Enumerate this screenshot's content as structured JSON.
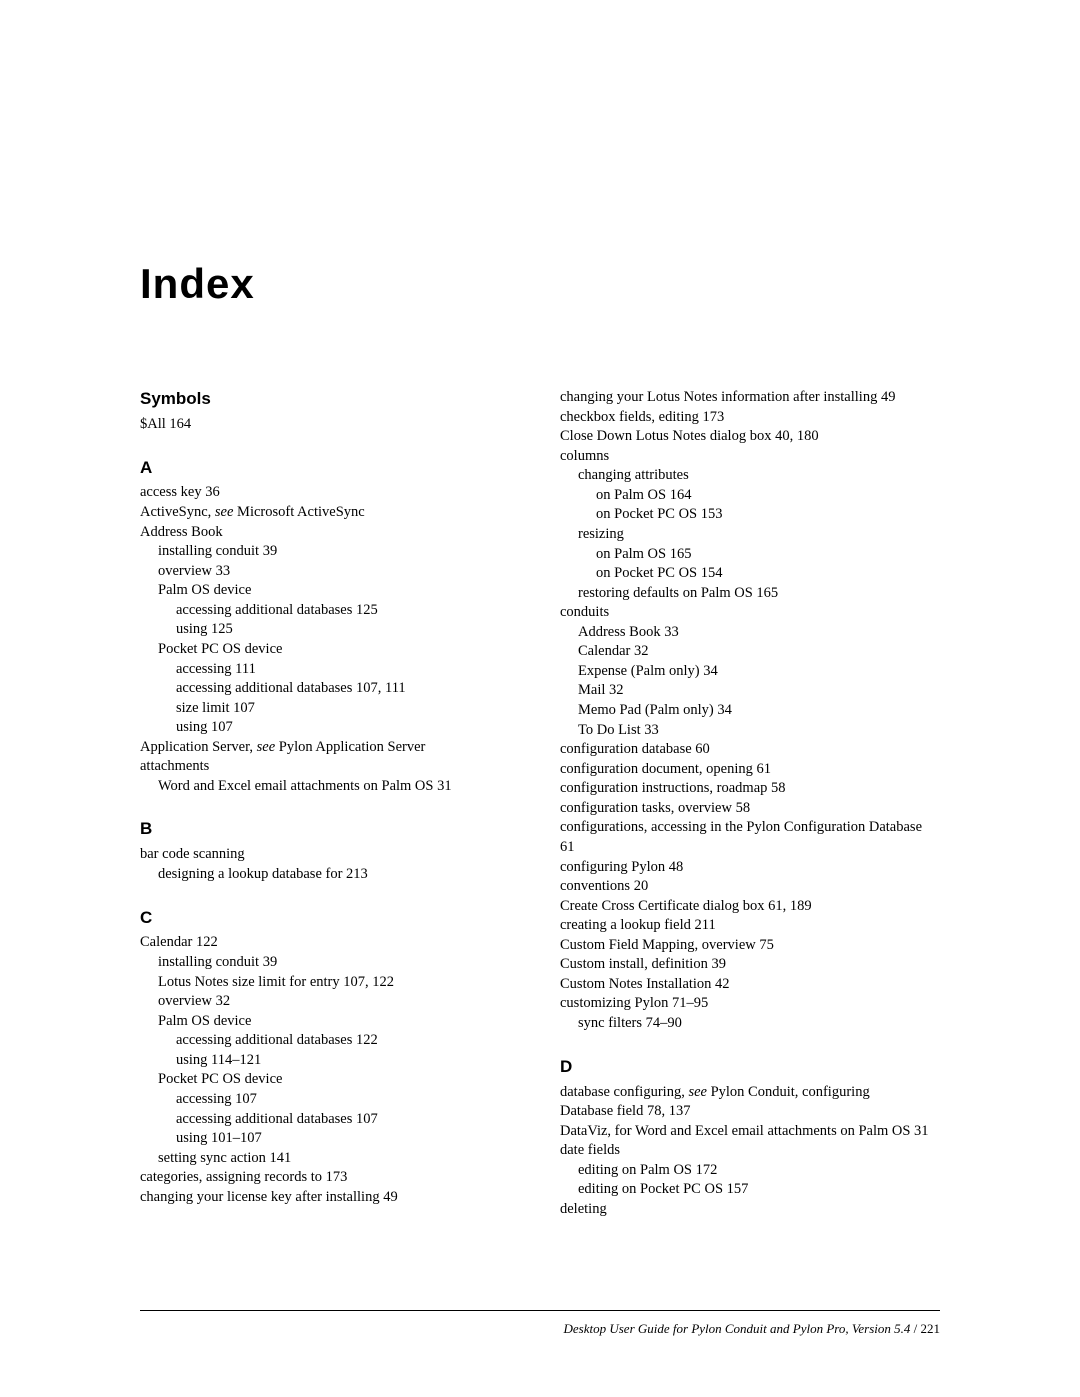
{
  "title": "Index",
  "sections": [
    {
      "head": "Symbols",
      "first": true,
      "lines": [
        [
          "$All  164",
          0
        ]
      ]
    },
    {
      "head": "A",
      "lines": [
        [
          "access key  36",
          0
        ],
        [
          "ActiveSync, <i>see</i> Microsoft ActiveSync",
          0
        ],
        [
          "Address Book",
          0
        ],
        [
          "installing conduit  39",
          1
        ],
        [
          "overview  33",
          1
        ],
        [
          "Palm OS device",
          1
        ],
        [
          "accessing additional databases  125",
          2
        ],
        [
          "using  125",
          2
        ],
        [
          "Pocket PC OS device",
          1
        ],
        [
          "accessing  111",
          2
        ],
        [
          "accessing additional databases  107, 111",
          2
        ],
        [
          "size limit  107",
          2
        ],
        [
          "using  107",
          2
        ],
        [
          "Application Server, <i>see</i> Pylon Application Server",
          0
        ],
        [
          "attachments",
          0
        ],
        [
          "Word and Excel email attachments on Palm OS  31",
          1
        ]
      ]
    },
    {
      "head": "B",
      "lines": [
        [
          "bar code scanning",
          0
        ],
        [
          "designing a lookup database for  213",
          1
        ]
      ]
    },
    {
      "head": "C",
      "lines": [
        [
          "Calendar  122",
          0
        ],
        [
          "installing conduit  39",
          1
        ],
        [
          "Lotus Notes size limit for entry  107, 122",
          1
        ],
        [
          "overview  32",
          1
        ],
        [
          "Palm OS device",
          1
        ],
        [
          "accessing additional databases  122",
          2
        ],
        [
          "using  114–121",
          2
        ],
        [
          "Pocket PC OS device",
          1
        ],
        [
          "accessing  107",
          2
        ],
        [
          "accessing additional databases  107",
          2
        ],
        [
          "using  101–107",
          2
        ],
        [
          "setting sync action  141",
          1
        ],
        [
          "categories, assigning records to  173",
          0
        ],
        [
          "changing your license key after installing  49",
          0
        ],
        [
          "changing your Lotus Notes information after installing  49",
          0
        ],
        [
          "checkbox fields, editing  173",
          0
        ],
        [
          "Close Down Lotus Notes dialog box  40, 180",
          0
        ],
        [
          "columns",
          0
        ],
        [
          "changing attributes",
          1
        ],
        [
          "on Palm OS  164",
          2
        ],
        [
          "on Pocket PC OS  153",
          2
        ],
        [
          "resizing",
          1
        ],
        [
          "on Palm OS  165",
          2
        ],
        [
          "on Pocket PC OS  154",
          2
        ],
        [
          "restoring defaults on Palm OS  165",
          1
        ],
        [
          "conduits",
          0
        ],
        [
          "Address Book  33",
          1
        ],
        [
          "Calendar  32",
          1
        ],
        [
          "Expense (Palm only)  34",
          1
        ],
        [
          "Mail  32",
          1
        ],
        [
          "Memo Pad (Palm only)  34",
          1
        ],
        [
          "To Do List  33",
          1
        ],
        [
          "configuration database  60",
          0
        ],
        [
          "configuration document, opening  61",
          0
        ],
        [
          "configuration instructions, roadmap  58",
          0
        ],
        [
          "configuration tasks, overview  58",
          0
        ],
        [
          "configurations, accessing in the Pylon Configuration Database  61",
          0
        ],
        [
          "configuring Pylon  48",
          0
        ],
        [
          "conventions  20",
          0
        ],
        [
          "Create Cross Certificate dialog box  61, 189",
          0
        ],
        [
          "creating a lookup field  211",
          0
        ],
        [
          "Custom Field Mapping, overview  75",
          0
        ],
        [
          "Custom install, definition  39",
          0
        ],
        [
          "Custom Notes Installation  42",
          0
        ],
        [
          "customizing Pylon  71–95",
          0
        ],
        [
          "sync filters  74–90",
          1
        ]
      ]
    },
    {
      "head": "D",
      "lines": [
        [
          "database configuring, <i>see</i> Pylon Conduit, configuring",
          0
        ],
        [
          "Database field  78, 137",
          0
        ],
        [
          "DataViz, for Word and Excel email attachments on Palm OS  31",
          0
        ],
        [
          "date fields",
          0
        ],
        [
          "editing on Palm OS  172",
          1
        ],
        [
          "editing on Pocket PC OS  157",
          1
        ],
        [
          "deleting",
          0
        ]
      ]
    }
  ],
  "footer": {
    "title": "Desktop User Guide for Pylon Conduit and Pylon Pro, Version 5.4",
    "sep": "  /  ",
    "page": "221"
  }
}
